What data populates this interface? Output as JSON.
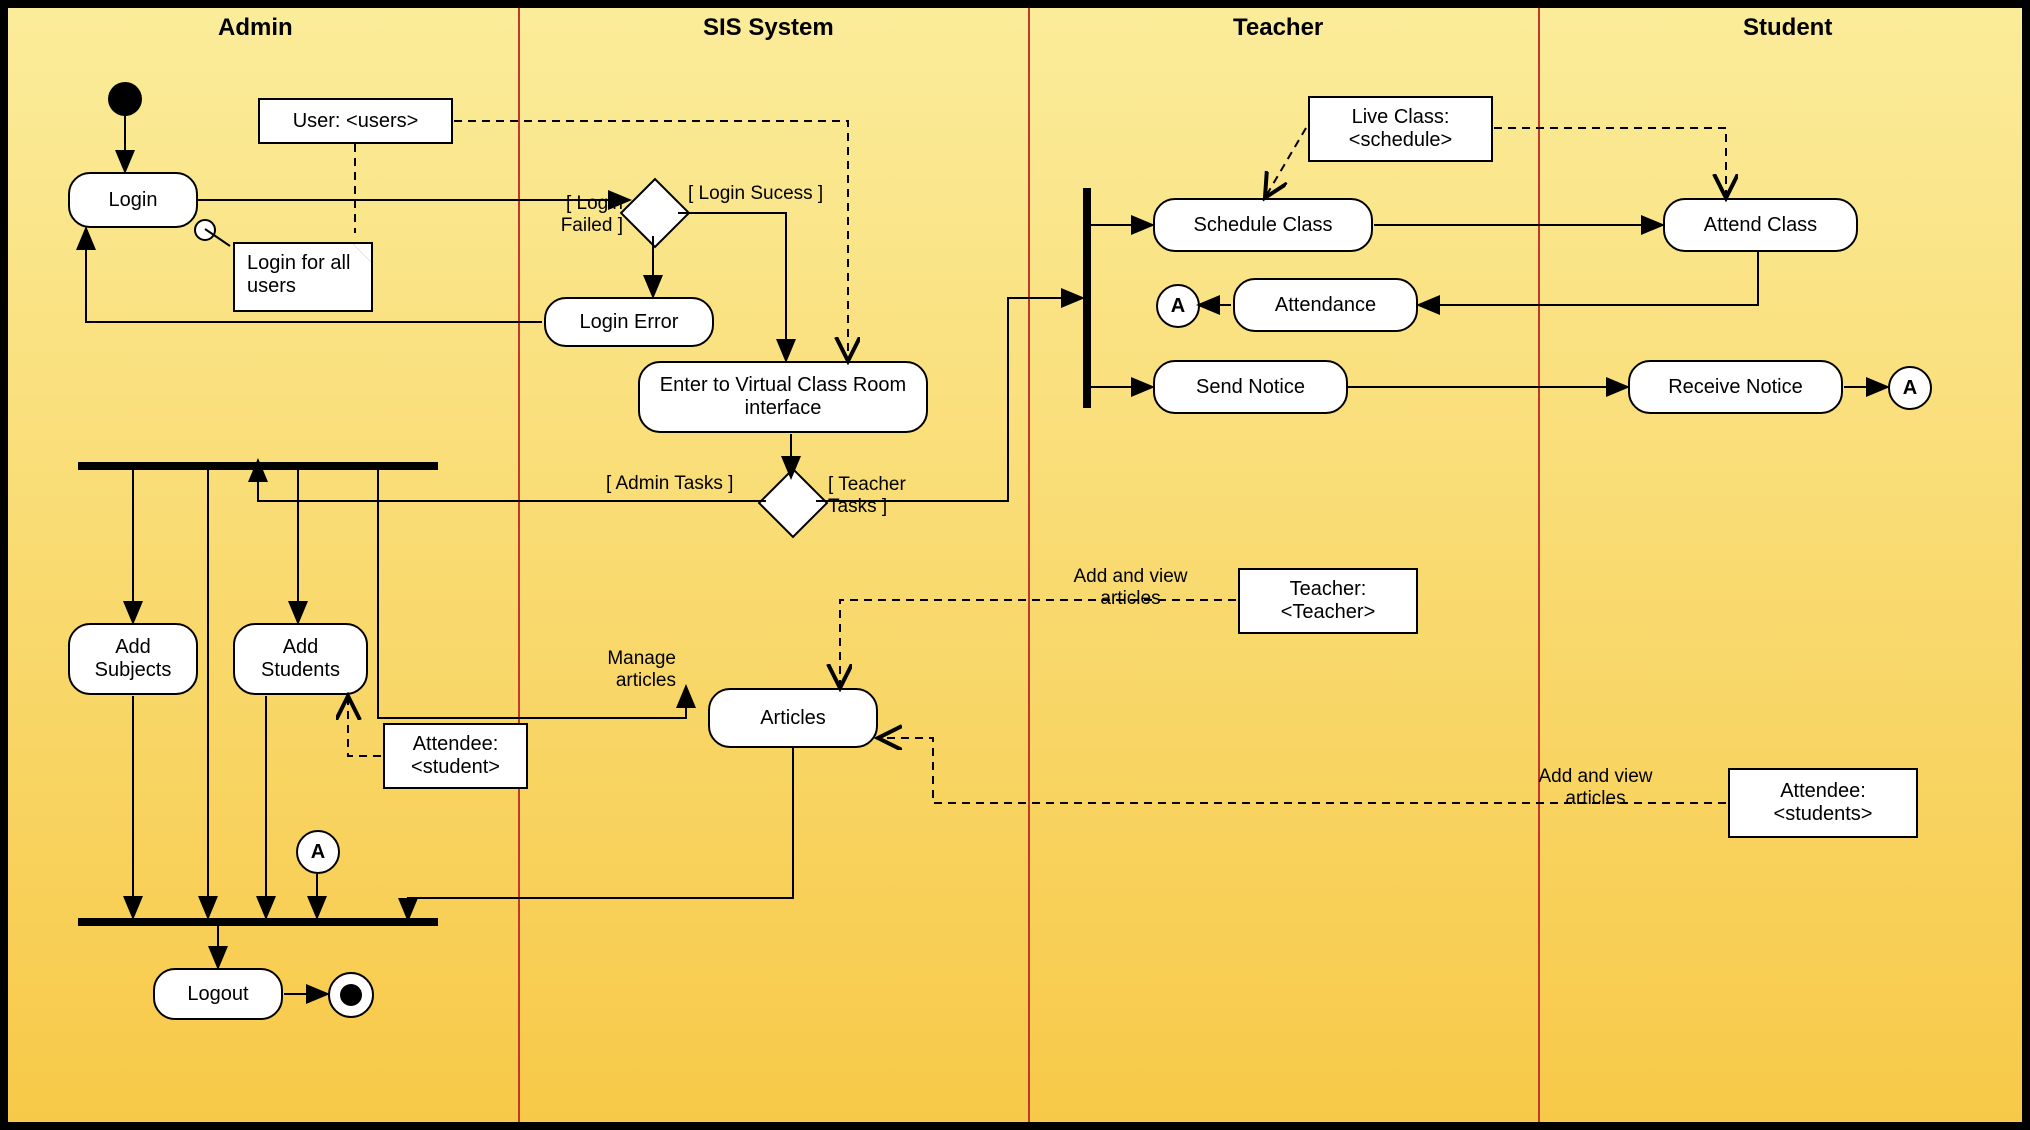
{
  "lanes": {
    "admin": "Admin",
    "sis": "SIS System",
    "teacher": "Teacher",
    "student": "Student"
  },
  "activities": {
    "login": "Login",
    "loginError": "Login Error",
    "enterVirtual": "Enter to Virtual Class Room interface",
    "scheduleClass": "Schedule Class",
    "attendClass": "Attend Class",
    "attendance": "Attendance",
    "sendNotice": "Send Notice",
    "receiveNotice": "Receive Notice",
    "articles": "Articles",
    "addSubjects": "Add Subjects",
    "addStudents": "Add Students",
    "logout": "Logout"
  },
  "objects": {
    "user": "User: <users>",
    "liveClass": "Live Class: <schedule>",
    "teacher": "Teacher: <Teacher>",
    "attendeeStudent": "Attendee: <student>",
    "attendeeStudents": "Attendee: <students>"
  },
  "note": {
    "loginNote": "Login for all users"
  },
  "guards": {
    "loginFailed": "[ Login Failed ]",
    "loginSuccess": "[ Login Sucess ]",
    "adminTasks": "[ Admin Tasks ]",
    "teacherTasks": "[ Teacher Tasks ]"
  },
  "labels": {
    "manageArticles": "Manage articles",
    "addViewArticles": "Add and view articles",
    "addViewArticles2": "Add and view articles",
    "connector": "A"
  }
}
